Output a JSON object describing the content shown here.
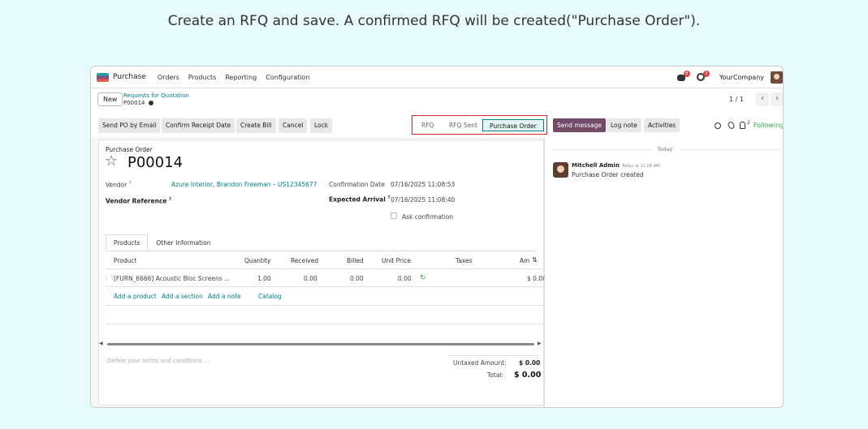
{
  "caption": "Create an RFQ and save. A confirmed RFQ will be created(\"Purchase Order\").",
  "navbar": {
    "app_name": "Purchase",
    "menu": [
      "Orders",
      "Products",
      "Reporting",
      "Configuration"
    ],
    "message_badge": "8",
    "activity_badge": "3",
    "company": "YourCompany"
  },
  "control": {
    "new_label": "New",
    "breadcrumb_parent": "Requests for Quotation",
    "breadcrumb_current": "P00014",
    "pager": "1 / 1",
    "prev": "‹",
    "next": "›"
  },
  "actions": {
    "send_po": "Send PO by Email",
    "confirm_receipt": "Confirm Receipt Date",
    "create_bill": "Create Bill",
    "cancel": "Cancel",
    "lock": "Lock"
  },
  "status": {
    "stages": [
      "RFQ",
      "RFQ Sent",
      "Purchase Order"
    ],
    "current": "Purchase Order",
    "highlight_color": "#d9262b"
  },
  "chatter_actions": {
    "send_message": "Send message",
    "log_note": "Log note",
    "activities": "Activities",
    "followers_count": "2",
    "following": "Following"
  },
  "form": {
    "doc_type": "Purchase Order",
    "name": "P00014",
    "vendor_label": "Vendor",
    "vendor_value": "Azure Interior, Brandon Freeman – US12345677",
    "vendor_ref_label": "Vendor Reference",
    "confirmation_label": "Confirmation Date",
    "confirmation_value": "07/16/2025 11:08:53",
    "expected_label": "Expected Arrival",
    "expected_value": "07/16/2025 11:08:40",
    "ask_confirmation": "Ask confirmation",
    "help_mark": "?"
  },
  "tabs": [
    "Products",
    "Other Information"
  ],
  "table": {
    "headers": [
      "Product",
      "Quantity",
      "Received",
      "Billed",
      "Unit Price",
      "Taxes",
      "Am"
    ],
    "row": {
      "product": "[FURN_6666] Acoustic Bloc Screens ...",
      "quantity": "1.00",
      "received": "0.00",
      "billed": "0.00",
      "unit_price": "0.00",
      "amount": "$ 0.00"
    },
    "add_links": [
      "Add a product",
      "Add a section",
      "Add a note",
      "Catalog"
    ]
  },
  "footer": {
    "terms_placeholder": "Define your terms and conditions ...",
    "untaxed_label": "Untaxed Amount:",
    "untaxed_value": "$ 0.00",
    "total_label": "Total:",
    "total_value": "$ 0.00"
  },
  "chatter": {
    "date_separator": "Today",
    "author": "Mitchell Admin",
    "time": "Today at 11:08 AM",
    "body": "Purchase Order created"
  }
}
